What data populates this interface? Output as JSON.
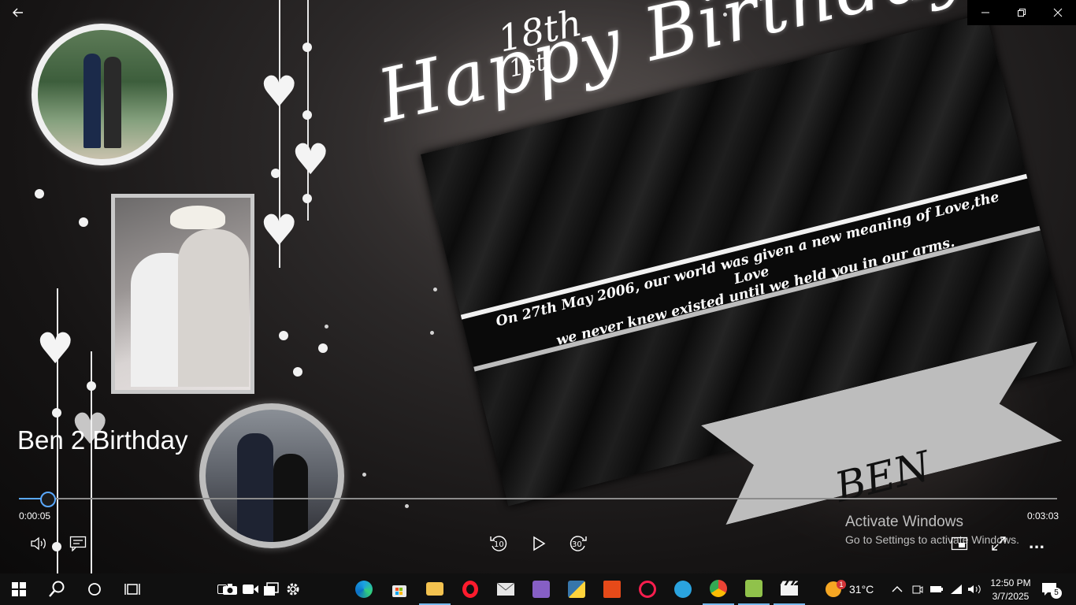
{
  "window": {
    "back_icon": "arrow-left-icon",
    "minimize_icon": "minimize-icon",
    "restore_icon": "restore-icon",
    "close_icon": "close-icon"
  },
  "video": {
    "title": "Ben 2 Birthday",
    "current_time": "0:00:05",
    "total_time": "0:03:03",
    "progress": 0.027,
    "frame": {
      "headline_small": "18th",
      "headline_small2": "1st",
      "headline": "Happy Birthday",
      "card_text_line1": "On 27th May 2006, our world was given a new meaning of Love,the Love",
      "card_text_line2": "we never knew existed until we held you in our arms.",
      "ribbon_text": "BEN"
    }
  },
  "controls": {
    "volume_icon": "volume-icon",
    "captions_icon": "captions-icon",
    "rewind_label": "10",
    "play_icon": "play-icon",
    "forward_label": "30",
    "miniplayer_icon": "miniplayer-icon",
    "fullscreen_icon": "fullscreen-icon",
    "more_label": "..."
  },
  "watermark": {
    "line1": "Activate Windows",
    "line2": "Go to Settings to activate Windows."
  },
  "taskbar": {
    "apps": [
      "start-icon",
      "search-icon",
      "cortana-icon",
      "task-view-icon",
      "widgets-icon",
      "camera-icon",
      "video-icon",
      "windows-icon",
      "settings-icon",
      "edge-icon",
      "store-icon",
      "file-explorer-icon",
      "opera-icon",
      "mail-icon",
      "visual-studio-icon",
      "python-icon",
      "office-icon",
      "opera-gx-icon",
      "telegram-icon",
      "chrome-icon",
      "notepadpp-icon",
      "movies-tv-icon"
    ],
    "weather_badge": "1",
    "temperature": "31°C",
    "time": "12:50 PM",
    "date": "3/7/2025",
    "notification_count": "5"
  },
  "colors": {
    "accent": "#5aa9ff",
    "taskbar": "#101010"
  }
}
